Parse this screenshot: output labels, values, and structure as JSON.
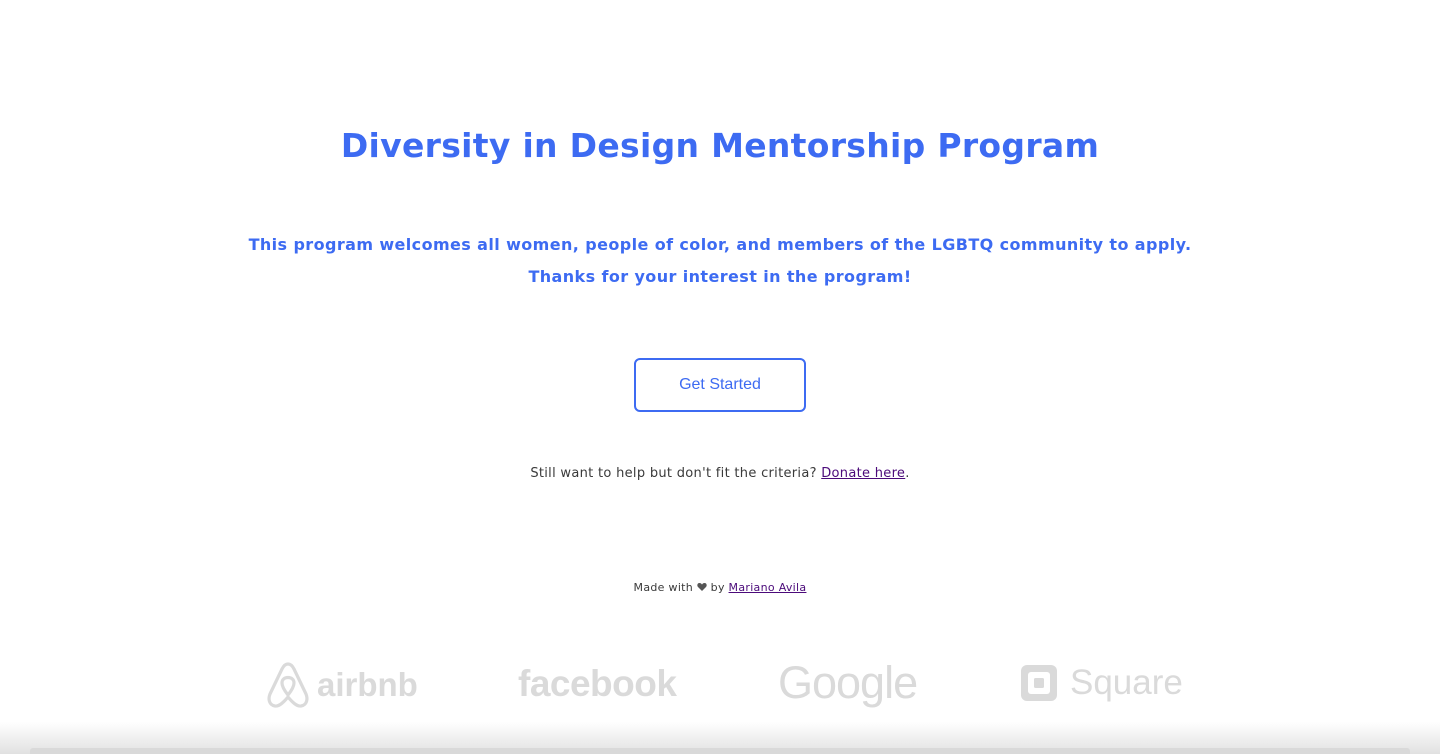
{
  "hero": {
    "title": "Diversity in Design Mentorship Program",
    "intro_line_1": "This program welcomes all women, people of color, and members of the LGBTQ community to apply.",
    "intro_line_2": "Thanks for your interest in the program!"
  },
  "cta": {
    "label": "Get Started"
  },
  "donate": {
    "prefix": "Still want to help but don't fit the criteria? ",
    "link_label": "Donate here",
    "suffix": "."
  },
  "credit": {
    "prefix": "Made with ",
    "middle": " by ",
    "author_link": "Mariano Avila"
  },
  "logos": {
    "airbnb": "airbnb",
    "facebook": "facebook",
    "google": "Google",
    "square": "Square"
  },
  "colors": {
    "accent": "#3d6bf2",
    "link_visited": "#4b0a7a",
    "logo_gray": "#dadada",
    "body_text": "#3a3a3a"
  },
  "icons": {
    "heart": "heart-icon",
    "airbnb": "airbnb-logo-icon",
    "square": "square-logo-icon"
  }
}
